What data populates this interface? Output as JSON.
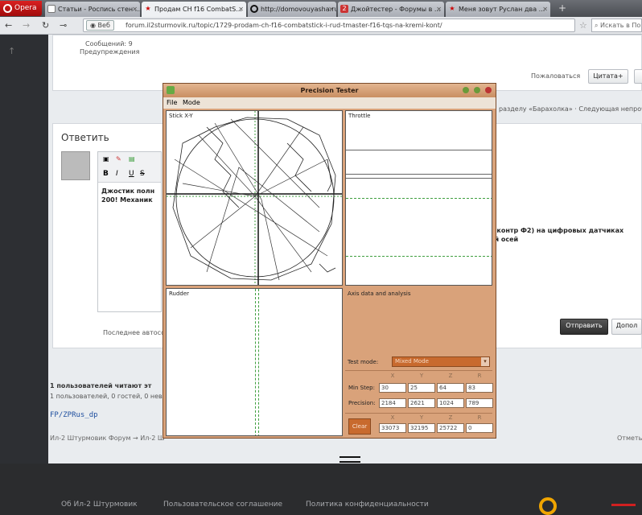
{
  "browser": {
    "opera_label": "Opera",
    "tabs": [
      {
        "label": "Статьи - Роспись стен ...",
        "icon": "page-icon"
      },
      {
        "label": "Продам CH f16 CombatS...",
        "icon": "star-icon"
      },
      {
        "label": "http://domovouyasha.ru/...",
        "icon": "ring-icon"
      },
      {
        "label": "Джойтестер - Форумы в ...",
        "icon": "forum-icon"
      },
      {
        "label": "Меня зовут Руслан два ...",
        "icon": "star-icon"
      }
    ],
    "new_tab": "+",
    "url_badge": "Веб",
    "url": "forum.il2sturmovik.ru/topic/1729-prodam-ch-f16-combatstick-i-rud-tmaster-f16-tqs-na-kremi-kont/",
    "search_placeholder": "Искать в Поис"
  },
  "forum": {
    "messages_label": "Сообщений: 9",
    "warnings_label": "Предупреждения",
    "complain": "Пожаловаться",
    "quote": "Цитата+",
    "nav_text": "разделу «Барахолка» · Следующая непрочт",
    "reply_title": "Ответить",
    "editor_text_line1": "Джостик полн",
    "editor_text_line1_right": "й контр Ф2) на цифровых датчиках",
    "editor_text_line2": "200! Механик",
    "editor_text_line2_right": "ой осей",
    "autosave": "Последнее автосо",
    "send": "Отправить",
    "preview": "Допол",
    "readers_title": "1 пользователей читают эт",
    "readers_sub": "1 пользователей, 0 гостей, 0 неви",
    "username": "FP/ZPRus_dp",
    "breadcrumb": "Ил-2 Штурмовик Форум → Ил-2 Ш",
    "breadcrumb_right": "Отметь"
  },
  "footer": {
    "links": [
      "Об Ил-2 Штурмовик",
      "Пользовательское соглашение",
      "Политика конфиденциальности"
    ]
  },
  "app": {
    "title": "Precision Tester",
    "menu": [
      "File",
      "Mode"
    ],
    "plots": {
      "stick": "Stick X-Y",
      "throttle": "Throttle",
      "rudder": "Rudder"
    },
    "analysis_label": "Axis data and analysis",
    "test_mode_label": "Test mode:",
    "test_mode_value": "Mixed Mode",
    "columns": [
      "X",
      "Y",
      "Z",
      "R"
    ],
    "min_step_label": "Min Step:",
    "min_step": [
      "30",
      "25",
      "64",
      "83"
    ],
    "precision_label": "Precision:",
    "precision": [
      "2184",
      "2621",
      "1024",
      "789"
    ],
    "clear": "Clear",
    "values": [
      "33073",
      "32195",
      "25722",
      "0"
    ]
  }
}
